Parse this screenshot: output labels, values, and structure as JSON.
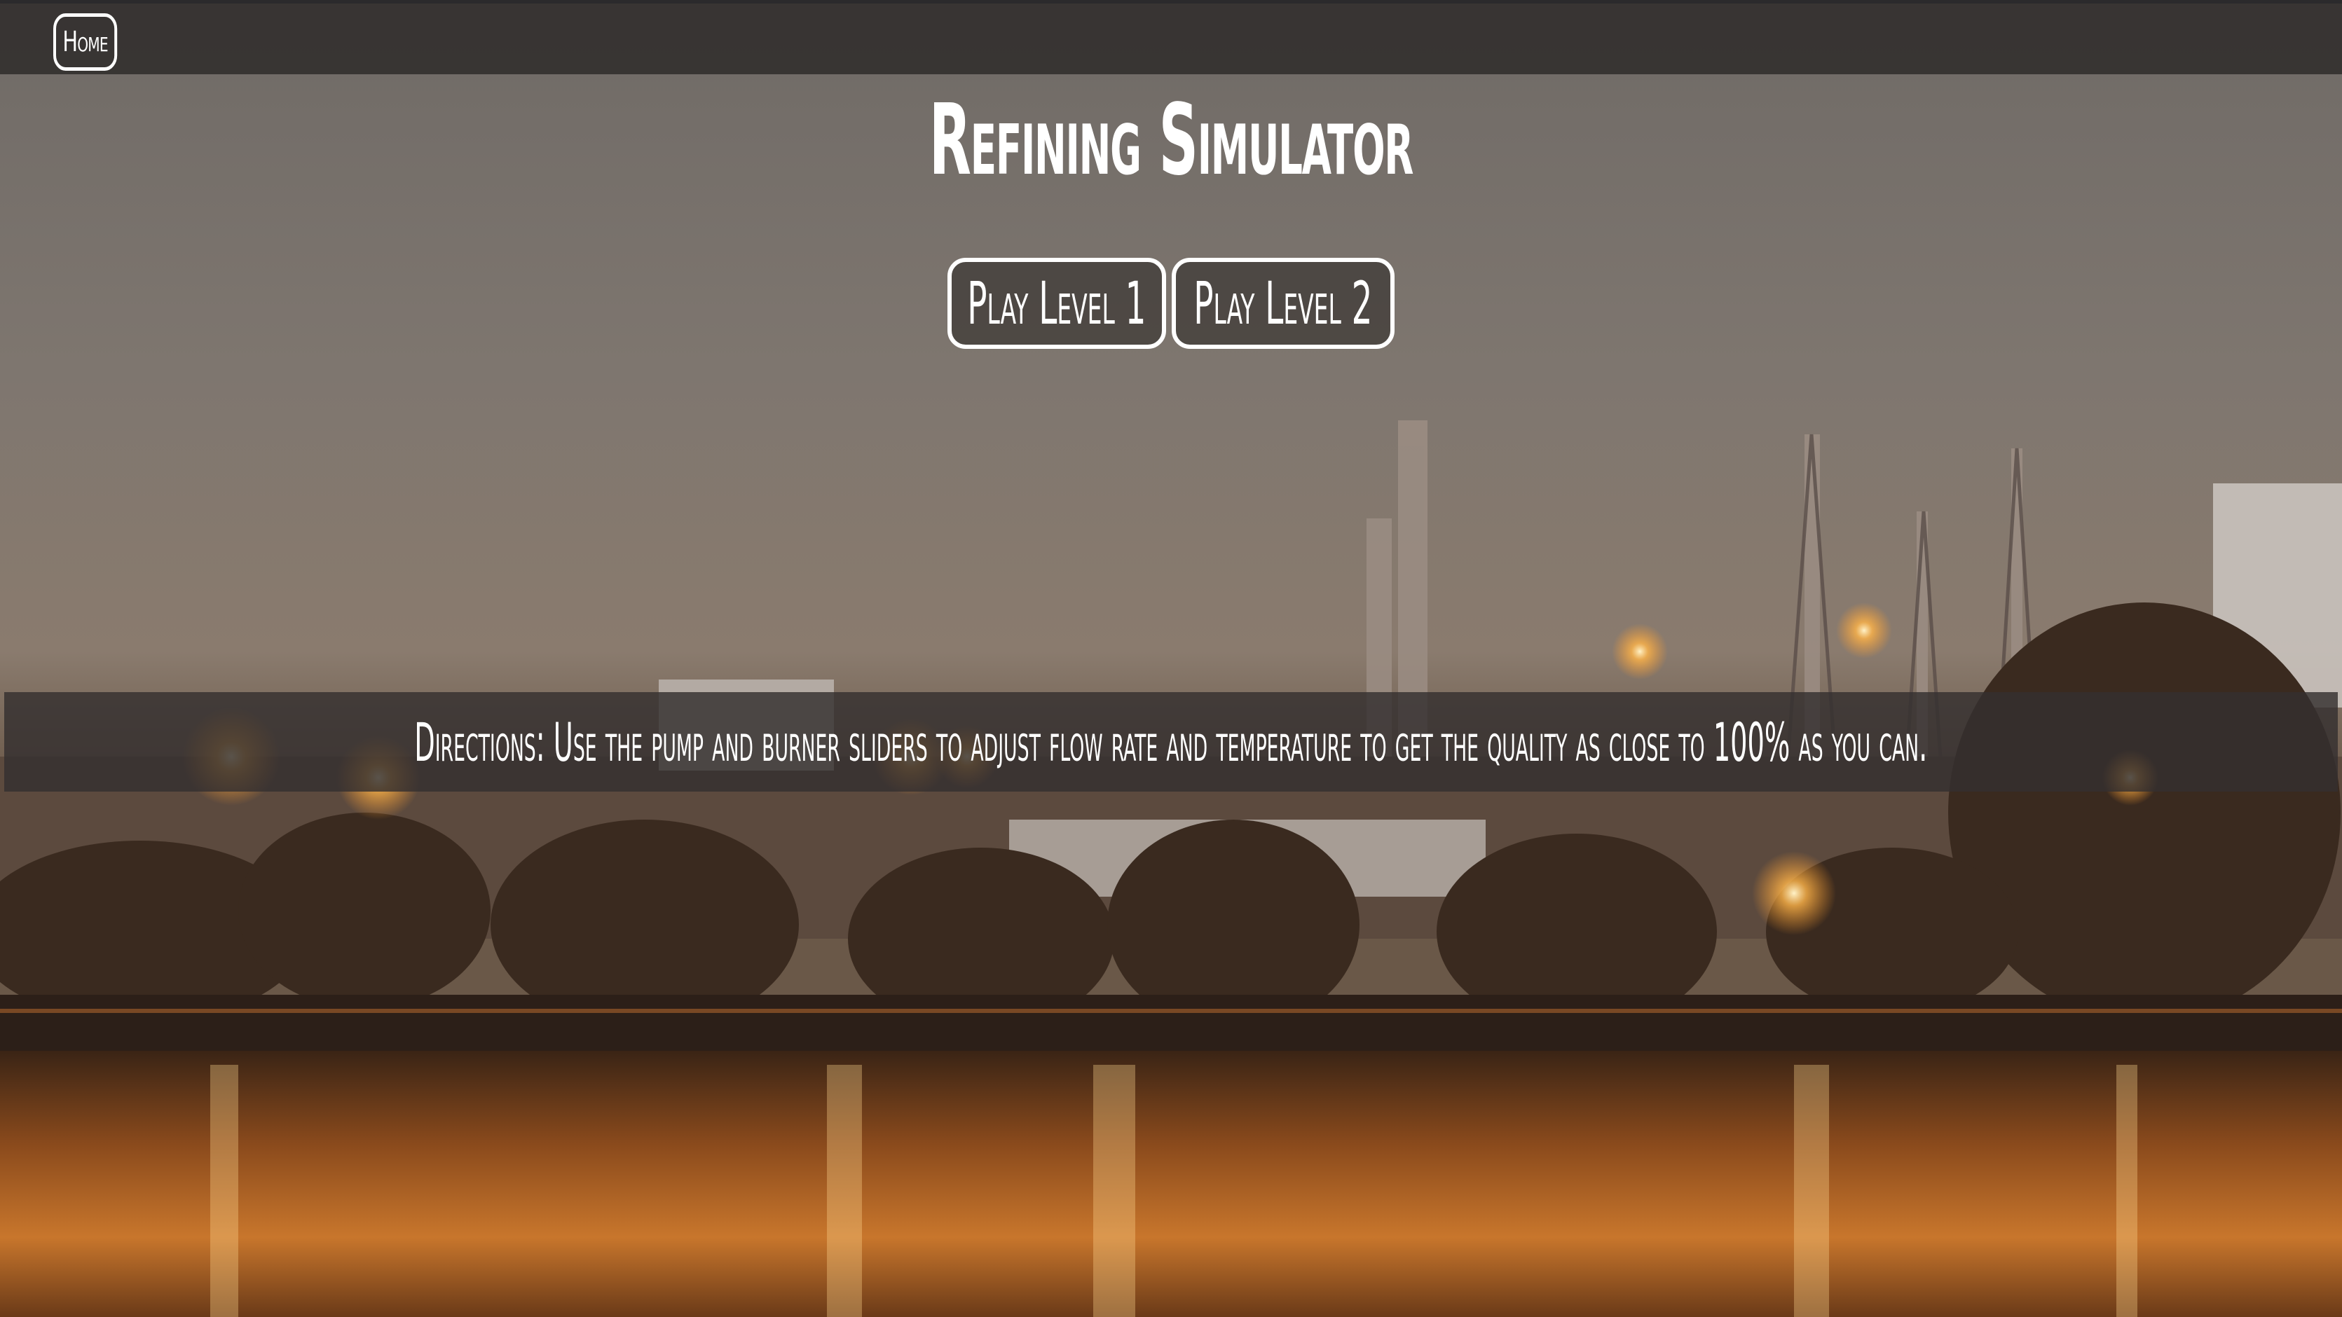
{
  "nav": {
    "home_label": "Home"
  },
  "main": {
    "title": "Refining Simulator",
    "level_buttons": [
      {
        "label": "Play Level 1"
      },
      {
        "label": "Play Level 2"
      }
    ],
    "directions": "Directions: Use the pump and burner sliders to adjust flow rate and temperature to get the quality as close to 100% as you can."
  },
  "colors": {
    "navbar": "#34302f",
    "text": "#ffffff",
    "sky": "#7d746a",
    "water_glow": "#d9862f"
  },
  "background": {
    "icon": "refinery-night-photo"
  }
}
